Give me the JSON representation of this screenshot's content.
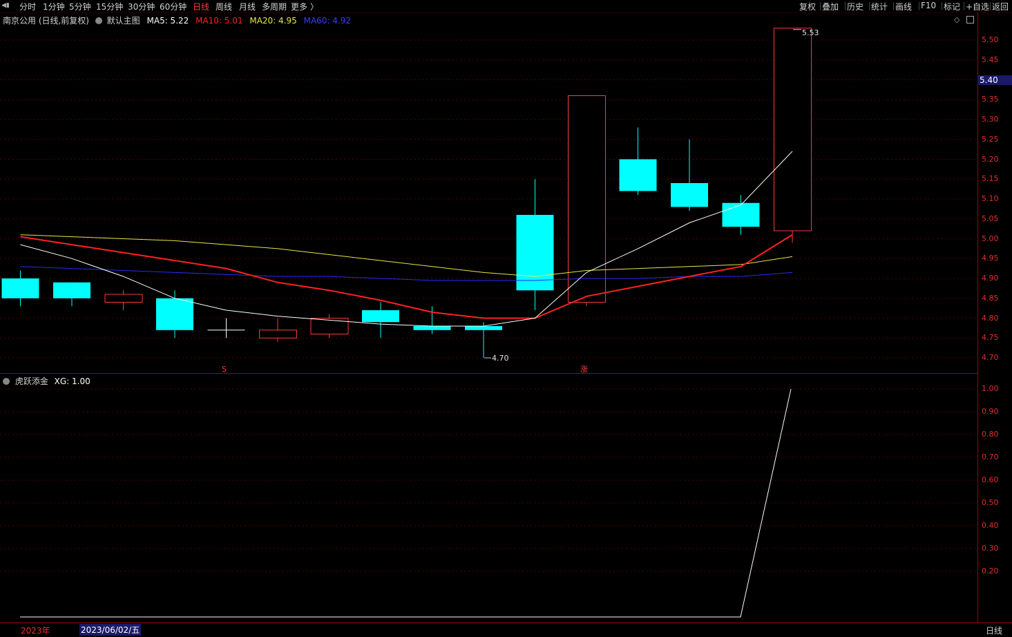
{
  "toolbar": {
    "left_items": [
      "分时",
      "1分钟",
      "5分钟",
      "15分钟",
      "30分钟",
      "60分钟",
      "日线",
      "周线",
      "月线",
      "多周期",
      "更多 〉"
    ],
    "active_index": 6,
    "right_items": [
      "复权",
      "叠加",
      "历史",
      "统计",
      "画线",
      "F10",
      "标记",
      "+自选",
      "返回"
    ]
  },
  "main_header": {
    "stock": "南京公用 (日线,前复权)",
    "template": "默认主图",
    "ma5": "MA5: 5.22",
    "ma10": "MA10: 5.01",
    "ma20": "MA20: 4.95",
    "ma60": "MA60: 4.92",
    "colors": {
      "ma5": "#ffffff",
      "ma10": "#ff2020",
      "ma20": "#e8e84a",
      "ma60": "#2a2aff",
      "up": "#ff3a3a",
      "down": "#00ffff"
    }
  },
  "sub_header": {
    "indicator": "虎跃添金",
    "xg": "XG: 1.00"
  },
  "price_axis": {
    "ticks": [
      "5.50",
      "5.45",
      "5.40",
      "5.35",
      "5.30",
      "5.25",
      "5.20",
      "5.15",
      "5.10",
      "5.05",
      "5.00",
      "4.95",
      "4.90",
      "4.85",
      "4.80",
      "4.75",
      "4.70"
    ],
    "current_price": "5.40"
  },
  "sub_axis": {
    "ticks": [
      "1.00",
      "0.90",
      "0.80",
      "0.70",
      "0.60",
      "0.50",
      "0.40",
      "0.30",
      "0.20"
    ]
  },
  "annotations": {
    "high_label": "5.53",
    "low_label": "4.70",
    "marker_s": "S",
    "marker_zhang": "涨"
  },
  "bottom": {
    "year": "2023年",
    "cursor_date": "2023/06/02/五",
    "period": "日线"
  },
  "chart_data": {
    "type": "candlestick",
    "y_range": [
      4.68,
      5.56
    ],
    "candles": [
      {
        "open": 4.9,
        "close": 4.85,
        "high": 4.92,
        "low": 4.83
      },
      {
        "open": 4.89,
        "close": 4.85,
        "high": 4.89,
        "low": 4.83
      },
      {
        "open": 4.84,
        "close": 4.86,
        "high": 4.87,
        "low": 4.82
      },
      {
        "open": 4.85,
        "close": 4.77,
        "high": 4.87,
        "low": 4.75
      },
      {
        "open": 4.77,
        "close": 4.77,
        "high": 4.8,
        "low": 4.75
      },
      {
        "open": 4.75,
        "close": 4.77,
        "high": 4.8,
        "low": 4.74
      },
      {
        "open": 4.76,
        "close": 4.8,
        "high": 4.81,
        "low": 4.75
      },
      {
        "open": 4.82,
        "close": 4.79,
        "high": 4.84,
        "low": 4.75
      },
      {
        "open": 4.78,
        "close": 4.77,
        "high": 4.83,
        "low": 4.76
      },
      {
        "open": 4.78,
        "close": 4.77,
        "high": 4.79,
        "low": 4.7
      },
      {
        "open": 5.06,
        "close": 4.87,
        "high": 5.15,
        "low": 4.82
      },
      {
        "open": 4.84,
        "close": 5.36,
        "high": 5.36,
        "low": 4.83
      },
      {
        "open": 5.2,
        "close": 5.12,
        "high": 5.28,
        "low": 5.11
      },
      {
        "open": 5.14,
        "close": 5.08,
        "high": 5.25,
        "low": 5.07
      },
      {
        "open": 5.09,
        "close": 5.03,
        "high": 5.11,
        "low": 5.01
      },
      {
        "open": 5.02,
        "close": 5.53,
        "high": 5.53,
        "low": 4.99
      }
    ],
    "ma5": [
      4.985,
      4.95,
      4.905,
      4.85,
      4.82,
      4.805,
      4.795,
      4.785,
      4.78,
      4.78,
      4.8,
      4.915,
      4.975,
      5.04,
      5.085,
      5.22
    ],
    "ma10": [
      5.005,
      4.985,
      4.965,
      4.945,
      4.925,
      4.89,
      4.87,
      4.845,
      4.815,
      4.8,
      4.8,
      4.855,
      4.88,
      4.905,
      4.93,
      5.01
    ],
    "ma20": [
      5.01,
      5.005,
      5.0,
      4.995,
      4.985,
      4.975,
      4.96,
      4.945,
      4.93,
      4.915,
      4.905,
      4.92,
      4.925,
      4.93,
      4.935,
      4.955
    ],
    "ma60": [
      4.93,
      4.925,
      4.92,
      4.915,
      4.91,
      4.905,
      4.905,
      4.9,
      4.895,
      4.895,
      4.895,
      4.9,
      4.9,
      4.905,
      4.905,
      4.915
    ],
    "xg": [
      0,
      0,
      0,
      0,
      0,
      0,
      0,
      0,
      0,
      0,
      0,
      0,
      0,
      0,
      0,
      1
    ]
  }
}
